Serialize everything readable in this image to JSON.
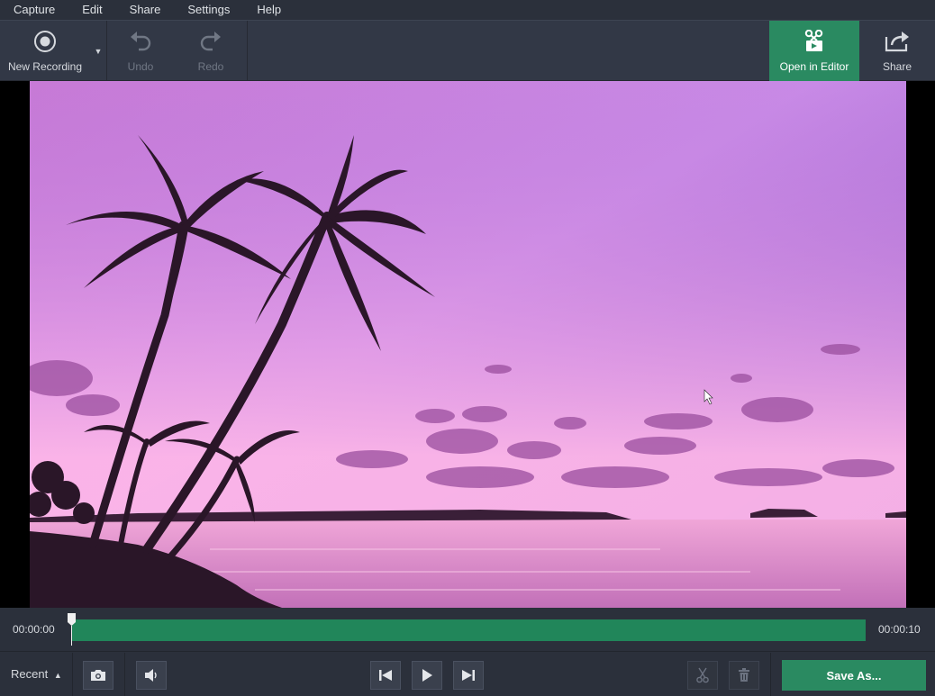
{
  "menu": [
    "Capture",
    "Edit",
    "Share",
    "Settings",
    "Help"
  ],
  "toolbar": {
    "new_recording": "New Recording",
    "undo": "Undo",
    "redo": "Redo",
    "open_in_editor": "Open in Editor",
    "share": "Share"
  },
  "timeline": {
    "start_time": "00:00:00",
    "end_time": "00:00:10",
    "playhead_fraction": 0.0
  },
  "bottom": {
    "recent": "Recent",
    "save_as": "Save As..."
  },
  "colors": {
    "accent": "#2a8a61",
    "track": "#21865a",
    "background": "#2b303b"
  }
}
